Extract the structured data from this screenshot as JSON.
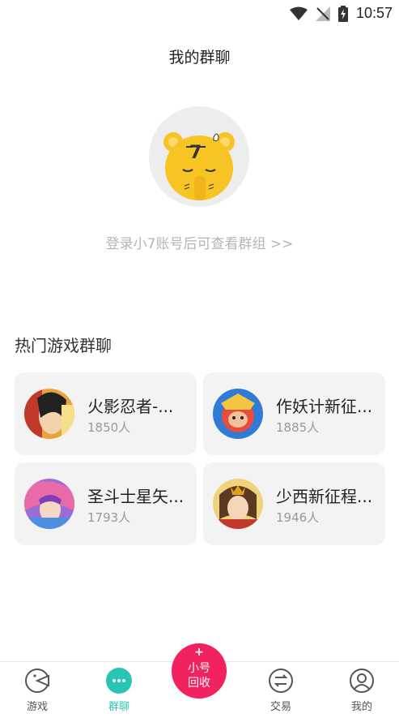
{
  "status_bar": {
    "time": "10:57",
    "icons": [
      "wifi-icon",
      "signal-icon",
      "battery-charging-icon"
    ]
  },
  "header": {
    "title": "我的群聊"
  },
  "empty_state": {
    "mascot": "cat-mascot-icon",
    "login_hint": "登录小7账号后可查看群组 >>"
  },
  "hot_section": {
    "title": "热门游戏群聊",
    "groups": [
      {
        "name": "火影忍者-...",
        "members": "1850人"
      },
      {
        "name": "作妖计新征...",
        "members": "1885人"
      },
      {
        "name": "圣斗士星矢...",
        "members": "1793人"
      },
      {
        "name": "少西新征程...",
        "members": "1946人"
      }
    ]
  },
  "bottom_nav": {
    "items": [
      {
        "label": "游戏",
        "icon": "pacman-icon"
      },
      {
        "label": "群聊",
        "icon": "chat-dots-icon",
        "active": true
      },
      {
        "label": "交易",
        "icon": "swap-icon"
      },
      {
        "label": "我的",
        "icon": "user-icon"
      }
    ],
    "center": {
      "plus": "+",
      "line1": "小号",
      "line2": "回收"
    }
  },
  "colors": {
    "accent": "#29c5b4",
    "center_button": "#f2215f",
    "mascot_yellow": "#f7c423"
  }
}
